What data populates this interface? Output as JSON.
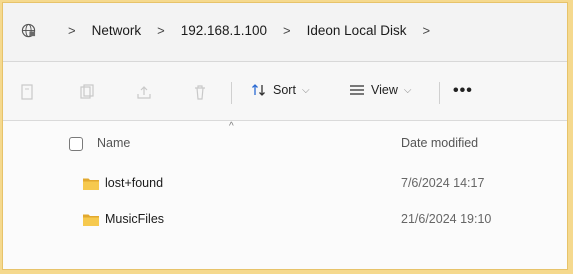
{
  "breadcrumb": {
    "icon": "network-globe-icon",
    "separator": ">",
    "items": [
      "Network",
      "192.168.1.100",
      "Ideon Local Disk"
    ],
    "trailing_separator": ">"
  },
  "toolbar": {
    "disabled_icons": [
      "cut-icon",
      "copy-icon",
      "share-icon",
      "delete-icon"
    ],
    "sort_label": "Sort",
    "view_label": "View",
    "more_label": "•••"
  },
  "columns": {
    "name": "Name",
    "date_modified": "Date modified",
    "sort_indicator": "^"
  },
  "files": [
    {
      "name": "lost+found",
      "date": "7/6/2024 14:17",
      "icon": "folder-icon"
    },
    {
      "name": "MusicFiles",
      "date": "21/6/2024 19:10",
      "icon": "folder-icon"
    }
  ],
  "colors": {
    "background_frame": "#f5d98e",
    "folder": "#f2c14e"
  }
}
